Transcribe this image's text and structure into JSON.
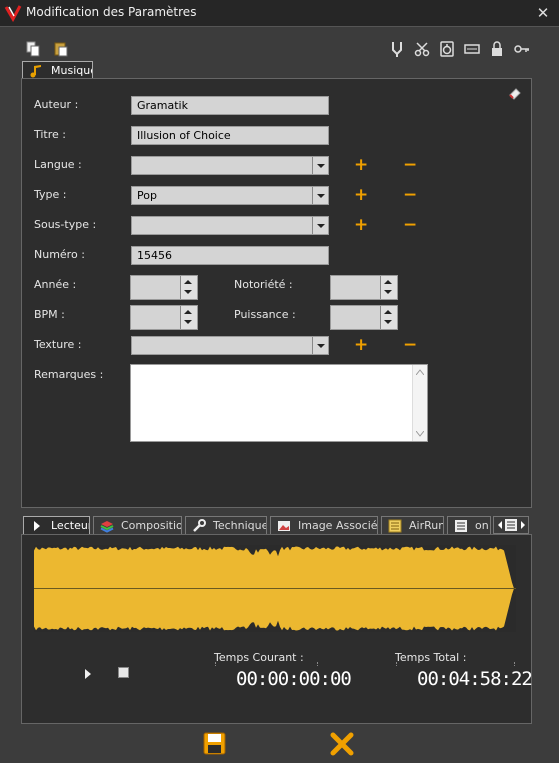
{
  "window": {
    "title": "Modification des Paramètres",
    "close_glyph": "✕"
  },
  "toolbar": {
    "left_icons": [
      "copy-icon",
      "paste-icon"
    ],
    "right_icons": [
      "tuning-fork-icon",
      "scissors-icon",
      "speaker-icon",
      "card-icon",
      "lock-icon",
      "key-icon"
    ]
  },
  "top_tab": {
    "label": "Musique",
    "icon": "music-note-icon"
  },
  "form": {
    "auteur": {
      "label": "Auteur :",
      "value": "Gramatik"
    },
    "titre": {
      "label": "Titre :",
      "value": "Illusion of Choice"
    },
    "langue": {
      "label": "Langue :",
      "value": ""
    },
    "type": {
      "label": "Type :",
      "value": "Pop"
    },
    "soustype": {
      "label": "Sous-type :",
      "value": ""
    },
    "numero": {
      "label": "Numéro :",
      "value": "15456"
    },
    "annee": {
      "label": "Année :",
      "value": ""
    },
    "notoriete": {
      "label": "Notoriété :",
      "value": ""
    },
    "bpm": {
      "label": "BPM :",
      "value": ""
    },
    "puissance": {
      "label": "Puissance :",
      "value": ""
    },
    "texture": {
      "label": "Texture :",
      "value": ""
    },
    "remarques": {
      "label": "Remarques :",
      "value": ""
    },
    "plus": "+",
    "minus": "−"
  },
  "bottom_tabs": [
    {
      "label": "Lecteur",
      "icon": "play-icon"
    },
    {
      "label": "Composition",
      "icon": "layers-icon"
    },
    {
      "label": "Technique",
      "icon": "wrench-icon"
    },
    {
      "label": "Image Associée",
      "icon": "image-icon"
    },
    {
      "label": "AirRun",
      "icon": "airrun-icon"
    },
    {
      "label": "on",
      "icon": "list-icon"
    }
  ],
  "player": {
    "current_label": "Temps Courant :",
    "current_time": "00:00:00:00",
    "total_label": "Temps Total :",
    "total_time": "00:04:58:22",
    "waveform_color": "#ecb830"
  },
  "colors": {
    "accent": "#f0a000",
    "background": "#3c3c3c",
    "panel": "#2d2d2d"
  }
}
